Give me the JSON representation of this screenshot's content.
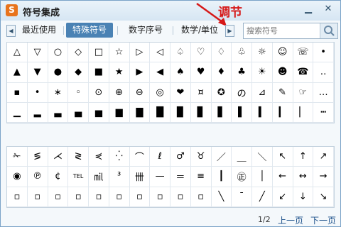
{
  "window": {
    "title": "符号集成",
    "logo_glyph": "S",
    "annotation": "调节",
    "minimize_glyph": "▁",
    "close_glyph": "✕"
  },
  "tabs": {
    "prev_glyph": "◀",
    "next_glyph": "▶",
    "items": [
      {
        "label": "最近使用",
        "active": false
      },
      {
        "label": "特殊符号",
        "active": true
      },
      {
        "label": "数字序号",
        "active": false
      },
      {
        "label": "数学/单位",
        "active": false
      }
    ]
  },
  "search": {
    "placeholder": "搜索符号",
    "icon": "search-icon"
  },
  "symbols_top": [
    "△",
    "▽",
    "○",
    "◇",
    "□",
    "☆",
    "▷",
    "◁",
    "♤",
    "♡",
    "♢",
    "♧",
    "☼",
    "☺",
    "☏",
    "•",
    "▲",
    "▼",
    "●",
    "◆",
    "■",
    "★",
    "▶",
    "◀",
    "♠",
    "♥",
    "♦",
    "♣",
    "☀",
    "☻",
    "☎",
    "‥",
    "▪",
    "•",
    "∗",
    "◦",
    "⊙",
    "⊕",
    "⊖",
    "◎",
    "❤",
    "¤",
    "✪",
    "の",
    "⊿",
    "✎",
    "☞",
    "…",
    "▁",
    "▂",
    "▃",
    "▄",
    "▅",
    "▆",
    "▇",
    "█",
    "▉",
    "▊",
    "▋",
    "▌",
    "▍",
    "▎",
    "▏",
    "┅"
  ],
  "symbols_bottom": [
    "✁",
    "≶",
    "⋌",
    "≷",
    "⋞",
    "⁛",
    "⌒",
    "ℓ",
    "♂",
    "♉",
    "／",
    "＿",
    "＼",
    "↖",
    "↑",
    "↗",
    "◉",
    "℗",
    "¢",
    "TEL",
    "㏕",
    "³",
    "卌",
    "—",
    "＝",
    "≡",
    "┃",
    "㊣",
    "│",
    "←",
    "↔",
    "→",
    "▫",
    "▫",
    "▫",
    "▫",
    "▫",
    "▫",
    "▫",
    "▫",
    "▫",
    "▫",
    "╲",
    "¯",
    "╱",
    "↙",
    "↓",
    "↘"
  ],
  "footer": {
    "page_indicator": "1/2",
    "prev_label": "上一页",
    "next_label": "下一页"
  },
  "colors": {
    "accent": "#4a82b4",
    "annotation": "#d61818",
    "logo": "#e8731c"
  }
}
